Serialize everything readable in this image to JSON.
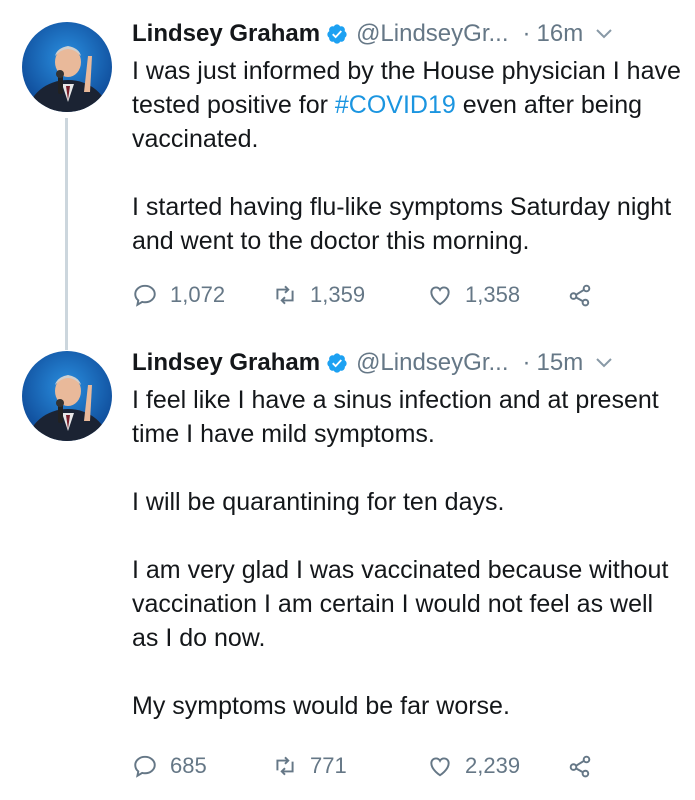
{
  "tweets": [
    {
      "name": "Lindsey Graham",
      "handle": "@LindseyGr...",
      "dot": "·",
      "time": "16m",
      "text_1a": "I was just informed by the House physician I have tested positive for ",
      "hashtag": "#COVID19",
      "text_1b": " even after being vaccinated.",
      "text_2": "I started having flu-like symptoms Saturday night and went to the doctor this morning.",
      "replies": "1,072",
      "retweets": "1,359",
      "likes": "1,358"
    },
    {
      "name": "Lindsey Graham",
      "handle": "@LindseyGr...",
      "dot": "·",
      "time": "15m",
      "paragraphs": [
        "I feel like I have a sinus infection and at present time I have mild symptoms.",
        "I will be quarantining for ten days.",
        "I am very glad I was vaccinated because without vaccination I am certain I would not feel as well as I do now.",
        "My symptoms would be far worse."
      ],
      "replies": "685",
      "retweets": "771",
      "likes": "2,239"
    }
  ],
  "icons": {
    "verified": "verified-badge-icon",
    "caret": "chevron-down-icon",
    "reply": "reply-icon",
    "retweet": "retweet-icon",
    "like": "heart-icon",
    "share": "share-icon"
  },
  "colors": {
    "accent": "#1da1f2",
    "hashtag": "#1b95e0",
    "muted": "#657786",
    "text": "#14171a",
    "thread_line": "#ccd6dd"
  }
}
